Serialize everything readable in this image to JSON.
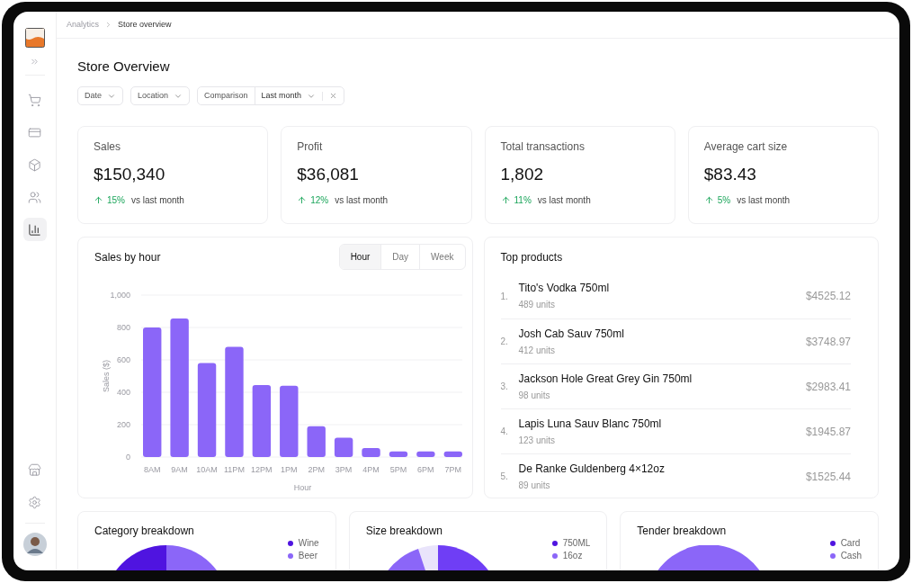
{
  "breadcrumb": [
    "Analytics",
    "Store overview"
  ],
  "sidebar": {
    "items": [
      {
        "selected": false
      },
      {
        "selected": false
      },
      {
        "selected": false
      },
      {
        "selected": false
      },
      {
        "selected": true
      }
    ],
    "bottom_items": [
      {
        "selected": false
      },
      {
        "selected": false
      }
    ]
  },
  "title": "Store Overview",
  "filters": [
    {
      "kind": "dropdown",
      "label": "Date"
    },
    {
      "kind": "dropdown",
      "label": "Location"
    },
    {
      "kind": "comparison",
      "label": "Comparison",
      "value": "Last month"
    }
  ],
  "stats": [
    {
      "label": "Sales",
      "value": "$150,340",
      "change": "15%",
      "note": "vs last month"
    },
    {
      "label": "Profit",
      "value": "$36,081",
      "change": "12%",
      "note": "vs last month"
    },
    {
      "label": "Total transactions",
      "value": "1,802",
      "change": "11%",
      "note": "vs last month"
    },
    {
      "label": "Average cart size",
      "value": "$83.43",
      "change": "5%",
      "note": "vs last month"
    }
  ],
  "sales_by_hour": {
    "title": "Sales by hour",
    "tabs": [
      {
        "label": "Hour",
        "selected": true
      },
      {
        "label": "Day",
        "selected": false
      },
      {
        "label": "Week",
        "selected": false
      }
    ],
    "chart_data": {
      "type": "bar",
      "xlabel": "Hour",
      "ylabel": "Sales ($)",
      "categories": [
        "8AM",
        "9AM",
        "10AM",
        "11PM",
        "12PM",
        "1PM",
        "2PM",
        "3PM",
        "4PM",
        "5PM",
        "6PM",
        "7PM"
      ],
      "grid": true,
      "series": [
        {
          "color": "#8b66f8",
          "values": [
            800,
            855,
            580,
            680,
            445,
            440,
            190,
            120,
            55,
            35,
            35,
            35
          ]
        }
      ],
      "ylim": [
        0,
        1000
      ],
      "yticks": [
        0,
        200,
        400,
        600,
        800,
        {
          "value": 1000,
          "label": "1,000"
        }
      ]
    }
  },
  "top_products": {
    "title": "Top products",
    "rows": [
      {
        "rank": "1.",
        "name": "Tito's Vodka 750ml",
        "units": "489 units",
        "amount": "$4525.12"
      },
      {
        "rank": "2.",
        "name": "Josh Cab Sauv 750ml",
        "units": "412 units",
        "amount": "$3748.97"
      },
      {
        "rank": "3.",
        "name": "Jackson Hole Great Grey Gin 750ml",
        "units": "98 units",
        "amount": "$2983.41"
      },
      {
        "rank": "4.",
        "name": "Lapis Luna Sauv Blanc 750ml",
        "units": "123 units",
        "amount": "$1945.87"
      },
      {
        "rank": "5.",
        "name": "De Ranke Guldenberg 4×12oz",
        "units": "89 units",
        "amount": "$1525.44"
      }
    ]
  },
  "breakdowns": [
    {
      "title": "Category breakdown",
      "legend": [
        {
          "label": "Wine",
          "color": "#4f14e0"
        },
        {
          "label": "Beer",
          "color": "#8b66f8"
        }
      ]
    },
    {
      "title": "Size breakdown",
      "legend": [
        {
          "label": "750ML",
          "color": "#4f14e0"
        },
        {
          "label": "16oz",
          "color": "#8b66f8"
        }
      ]
    },
    {
      "title": "Tender breakdown",
      "legend": [
        {
          "label": "Card",
          "color": "#4f14e0"
        },
        {
          "label": "Cash",
          "color": "#8b66f8"
        }
      ]
    }
  ]
}
